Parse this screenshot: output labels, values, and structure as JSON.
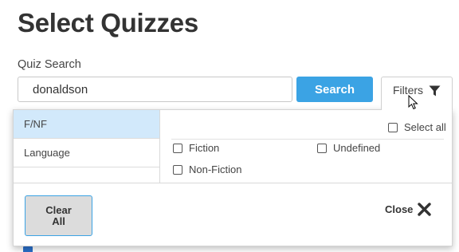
{
  "page": {
    "title": "Select Quizzes"
  },
  "search": {
    "label": "Quiz Search",
    "value": "donaldson",
    "button_label": "Search"
  },
  "filters": {
    "button_label": "Filters",
    "icon": "funnel-icon",
    "categories": [
      {
        "label": "F/NF",
        "active": true
      },
      {
        "label": "Language",
        "active": false
      }
    ],
    "select_all_label": "Select all",
    "options": [
      {
        "label": "Fiction",
        "checked": false
      },
      {
        "label": "Undefined",
        "checked": false
      },
      {
        "label": "Non-Fiction",
        "checked": false
      }
    ],
    "clear_label": "Clear\nAll",
    "close_label": "Close",
    "close_icon": "close-x-icon"
  },
  "colors": {
    "primary": "#3ba3e4",
    "active_category_bg": "#d2e9fb",
    "text": "#333333"
  }
}
